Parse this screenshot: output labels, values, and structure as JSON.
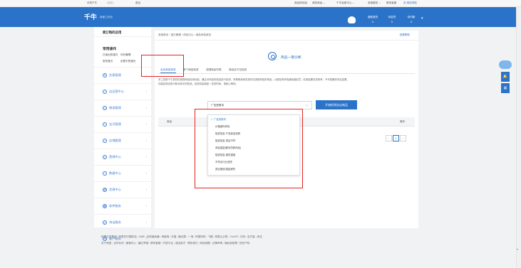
{
  "topbar": {
    "left_items": [
      "手机千牛",
      "(保密)",
      "退出"
    ],
    "right_items": [
      "商品网页版",
      "我的商品 ⌄",
      "千牛卖家中心 ⌄",
      "卖家服务 ⌄",
      "联系客服",
      "▦ 网站导航"
    ]
  },
  "header": {
    "logo": "千牛",
    "logo_sub": "卖家工作台",
    "stats": [
      {
        "label": "退款退货",
        "value": "0"
      },
      {
        "label": "待发货",
        "value": "0"
      },
      {
        "label": "待付款",
        "value": "0"
      }
    ],
    "caret": "▾"
  },
  "sidebar": {
    "top_head": "我订购的应用",
    "common_title": "常用操作",
    "common_links": [
      "已卖出的宝贝",
      "评价管理",
      "发布宝贝",
      "出售中的宝贝"
    ],
    "items": [
      {
        "label": "交易管理",
        "icon": "trade-icon",
        "glyph": "¥"
      },
      {
        "label": "自运营中心",
        "icon": "operation-icon",
        "glyph": "○"
      },
      {
        "label": "物流管理",
        "icon": "logistics-icon",
        "glyph": "▭"
      },
      {
        "label": "宝贝管理",
        "icon": "goods-icon",
        "glyph": "□"
      },
      {
        "label": "店铺管理",
        "icon": "shop-icon",
        "glyph": "⌂"
      },
      {
        "label": "营销中心",
        "icon": "marketing-icon",
        "glyph": "◇"
      },
      {
        "label": "数据中心",
        "icon": "data-icon",
        "glyph": "◔"
      },
      {
        "label": "货源中心",
        "icon": "supply-icon",
        "glyph": "▤"
      },
      {
        "label": "软件服务",
        "icon": "software-icon",
        "glyph": "▦"
      },
      {
        "label": "淘宝服务",
        "icon": "taobao-service-icon",
        "glyph": "◎"
      },
      {
        "label": "客户服务",
        "icon": "customer-service-icon",
        "glyph": "☏"
      }
    ],
    "chevron": "›"
  },
  "main": {
    "breadcrumb": "卖家首页 › 宝贝管理 › 体检中心 › 商品体检首页",
    "help": "查看帮助",
    "feature_title": "商品一键诊断",
    "tabs": [
      "全店商品检查",
      "单个商品检查",
      "违规商品列表",
      "商品全方位检查"
    ],
    "description": [
      "本工具是千牛提供的违规商品检测功能，通过对商品的信息进行检测，来帮助卖家发现存在违规风险的商品，以便及时修改避免被处罚，检测结果仅供参考，不代表最终判定结果。",
      "仅能检测出售中和仓库中的商品，检测将会耗费一定的时间，请耐心等待。"
    ],
    "select": {
      "value": "广告违规词",
      "arrow": "︿"
    },
    "start_button": "开始检测全店商品",
    "table": {
      "col_product": "商品",
      "col_action": "操作"
    },
    "dropdown_options": [
      {
        "label": "广告违规词",
        "checked": true
      },
      {
        "label": "价格虚构风险",
        "checked": false
      },
      {
        "label": "描述信息-产品信息违规",
        "checked": false
      },
      {
        "label": "描述信息-类目不符",
        "checked": false
      },
      {
        "label": "商品重复铺货(同款商品)",
        "checked": false
      },
      {
        "label": "描述信息-属性错误",
        "checked": false
      },
      {
        "label": "不符合行业资质",
        "checked": false
      },
      {
        "label": "类目错放/重复铺货",
        "checked": false
      }
    ],
    "check_mark": "✓",
    "pager": {
      "prev": "‹",
      "current": "1",
      "next": "›"
    }
  },
  "floating": {
    "bell": "🔔",
    "chat": "▤"
  },
  "footer": {
    "line1": [
      "阿里巴巴集团",
      "阿里巴巴国际站",
      "1688",
      "全球速卖通",
      "淘宝网",
      "天猫",
      "聚划算",
      "一淘",
      "阿里妈妈",
      "飞猪",
      "阿里云计算",
      "YunOS",
      "万网",
      "支付宝",
      "来往"
    ],
    "line2": [
      "关于淘宝",
      "合作伙伴",
      "营销中心",
      "廉正举报",
      "联系客服",
      "开放平台",
      "诚征英才",
      "联系我们",
      "网站地图",
      "法律声明",
      "隐私权政策",
      "知识产权"
    ]
  },
  "colors": {
    "brand_blue": "#2b73c9",
    "highlight_red": "#e6231f"
  }
}
